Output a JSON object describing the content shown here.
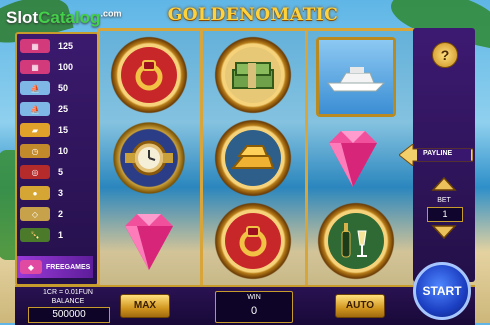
{
  "watermark": {
    "slot": "Slot",
    "catalog": "Catalog",
    "com": ".com"
  },
  "logo": "GOLDENOMATIC",
  "paytable": {
    "rows": [
      {
        "icon": "slot-machine-icon",
        "value": "125"
      },
      {
        "icon": "slot-machine-icon",
        "value": "100"
      },
      {
        "icon": "yacht-icon",
        "value": "50"
      },
      {
        "icon": "yacht-icon",
        "value": "25"
      },
      {
        "icon": "gold-bars-icon",
        "value": "15"
      },
      {
        "icon": "gold-watch-icon",
        "value": "10"
      },
      {
        "icon": "gold-ring-icon",
        "value": "5"
      },
      {
        "icon": "gold-coin-icon",
        "value": "3"
      },
      {
        "icon": "diamond-ring-icon",
        "value": "2"
      },
      {
        "icon": "champagne-icon",
        "value": "1"
      }
    ],
    "freegames": "FREEGAMES"
  },
  "reels": [
    [
      "ruby-ring-icon",
      "gold-watch-icon",
      "pink-diamond-icon"
    ],
    [
      "cash-stack-icon",
      "gold-bars-icon",
      "ruby-ring-icon"
    ],
    [
      "yacht-icon",
      "pink-diamond-icon",
      "champagne-icon"
    ]
  ],
  "right_panel": {
    "help": "?",
    "payline": "PAYLINE",
    "bet_label": "BET",
    "bet_value": "1"
  },
  "bottom": {
    "cr": "1CR = 0.01FUN",
    "balance_label": "BALANCE",
    "balance_value": "500000",
    "max": "MAX",
    "win_label": "WIN",
    "win_value": "0",
    "auto": "AUTO",
    "start": "START"
  },
  "colors": {
    "gold": "#d7a53a",
    "purple": "#2a1252",
    "start_blue": "#1c3fc2"
  }
}
